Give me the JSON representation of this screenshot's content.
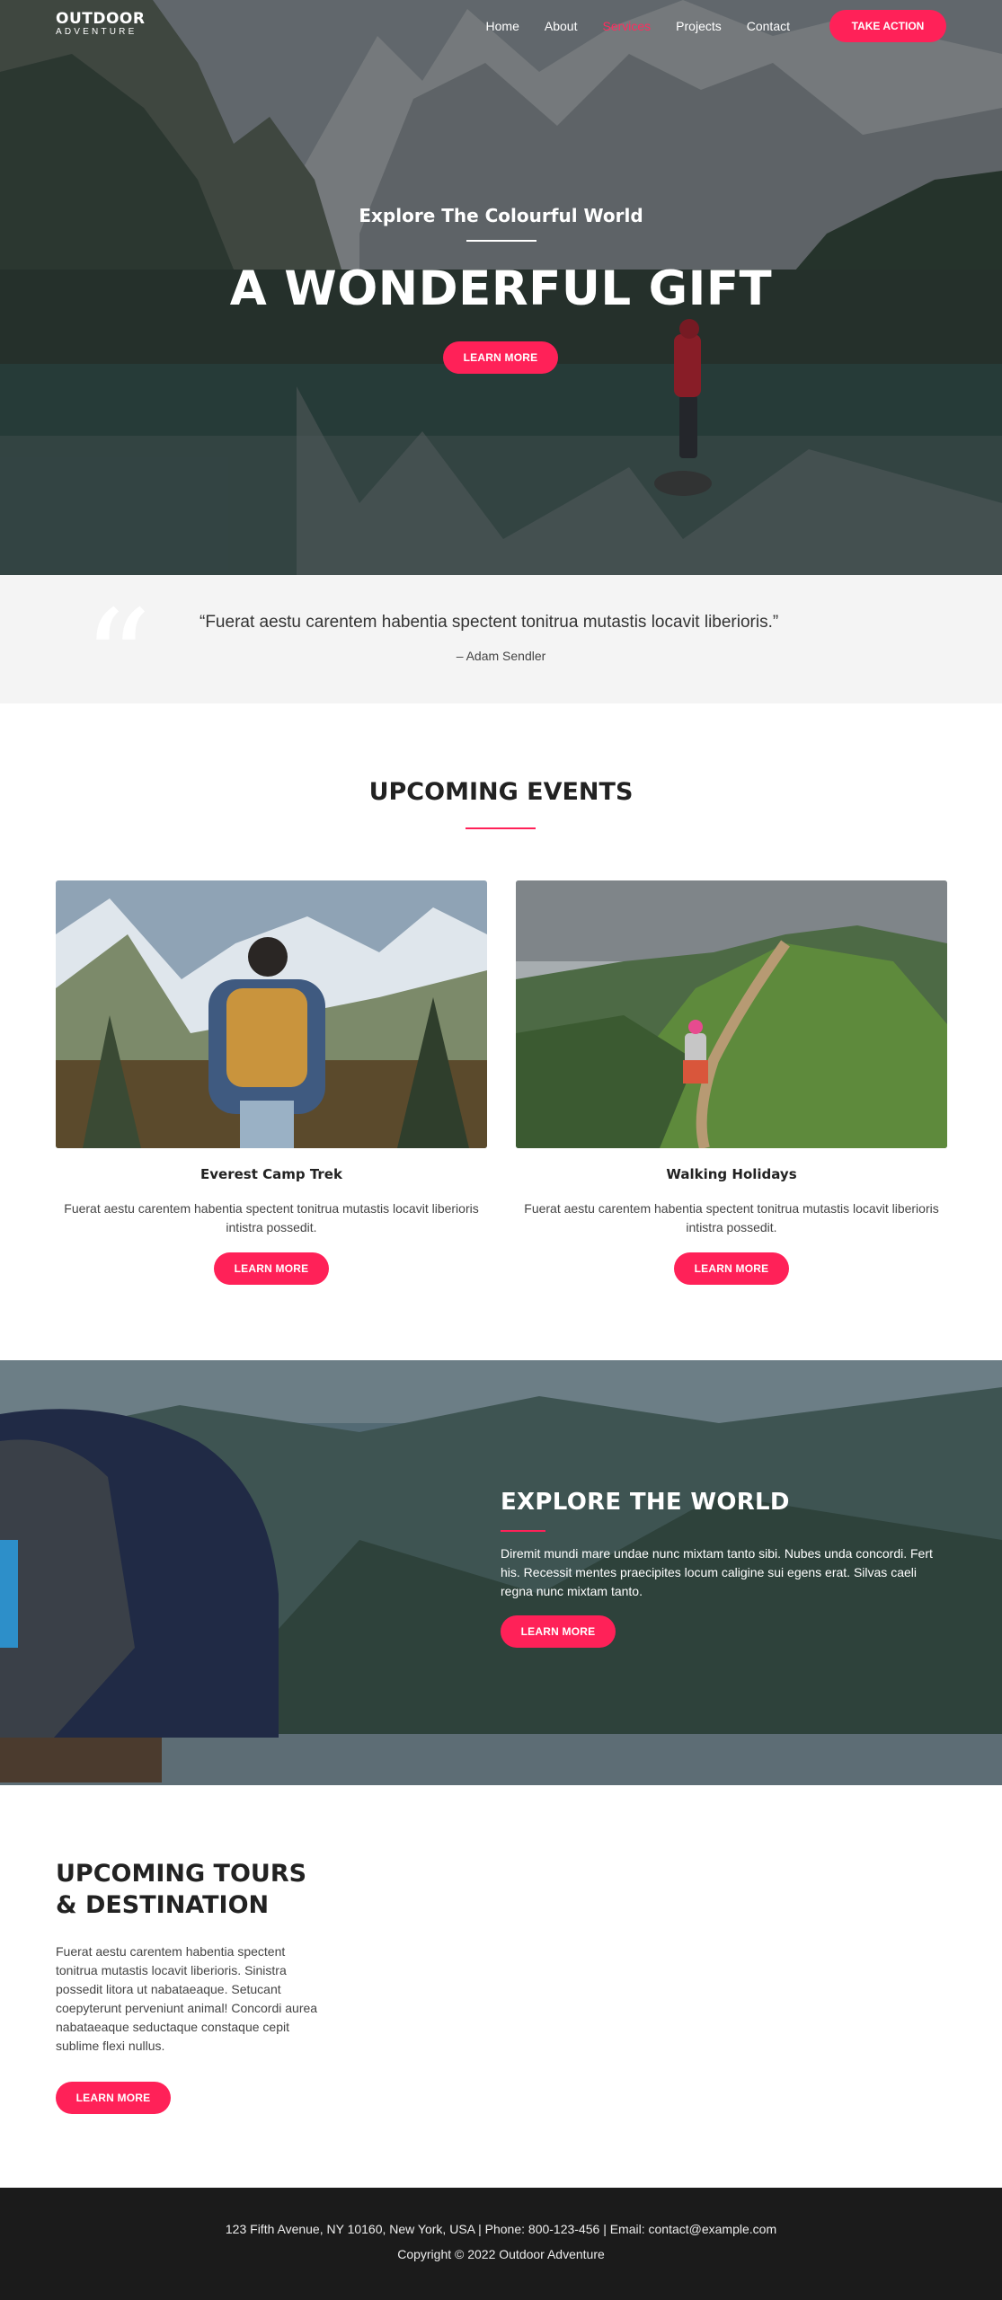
{
  "header": {
    "logo_title": "OUTDOOR",
    "logo_subtitle": "ADVENTURE",
    "nav": [
      "Home",
      "About",
      "Services",
      "Projects",
      "Contact"
    ],
    "active_nav": "Services",
    "cta_label": "TAKE ACTION"
  },
  "hero": {
    "subtitle": "Explore The Colourful World",
    "title": "A WONDERFUL GIFT",
    "button_label": "LEARN MORE"
  },
  "quote": {
    "mark": "“",
    "text": "“Fuerat aestu carentem habentia spectent tonitrua mutastis locavit liberioris.”",
    "author": "– Adam Sendler"
  },
  "events": {
    "title": "UPCOMING EVENTS",
    "cards": [
      {
        "name": "Everest Camp Trek",
        "description": "Fuerat aestu carentem habentia spectent tonitrua mutastis locavit liberioris intistra possedit.",
        "button_label": "LEARN MORE"
      },
      {
        "name": "Walking Holidays",
        "description": "Fuerat aestu carentem habentia spectent tonitrua mutastis locavit liberioris intistra possedit.",
        "button_label": "LEARN MORE"
      }
    ]
  },
  "explore": {
    "title": "EXPLORE THE WORLD",
    "text": "Diremit mundi mare undae nunc mixtam tanto sibi. Nubes unda concordi. Fert his. Recessit mentes praecipites locum caligine sui egens erat. Silvas caeli regna nunc mixtam tanto.",
    "button_label": "LEARN MORE"
  },
  "tours": {
    "title": "UPCOMING TOURS & DESTINATION",
    "text": "Fuerat aestu carentem habentia spectent tonitrua mutastis locavit liberioris. Sinistra possedit litora ut nabataeaque. Setucant coepyterunt perveniunt animal! Concordi aurea nabataeaque seductaque constaque cepit sublime flexi nullus.",
    "button_label": "LEARN MORE"
  },
  "footer": {
    "contact": "123 Fifth Avenue, NY 10160, New York, USA | Phone: 800-123-456 | Email: contact@example.com",
    "copyright": "Copyright © 2022 Outdoor Adventure"
  },
  "colors": {
    "accent": "#ff2158",
    "footer_bg": "#1b1b1b",
    "quote_bg": "#f4f4f4"
  }
}
